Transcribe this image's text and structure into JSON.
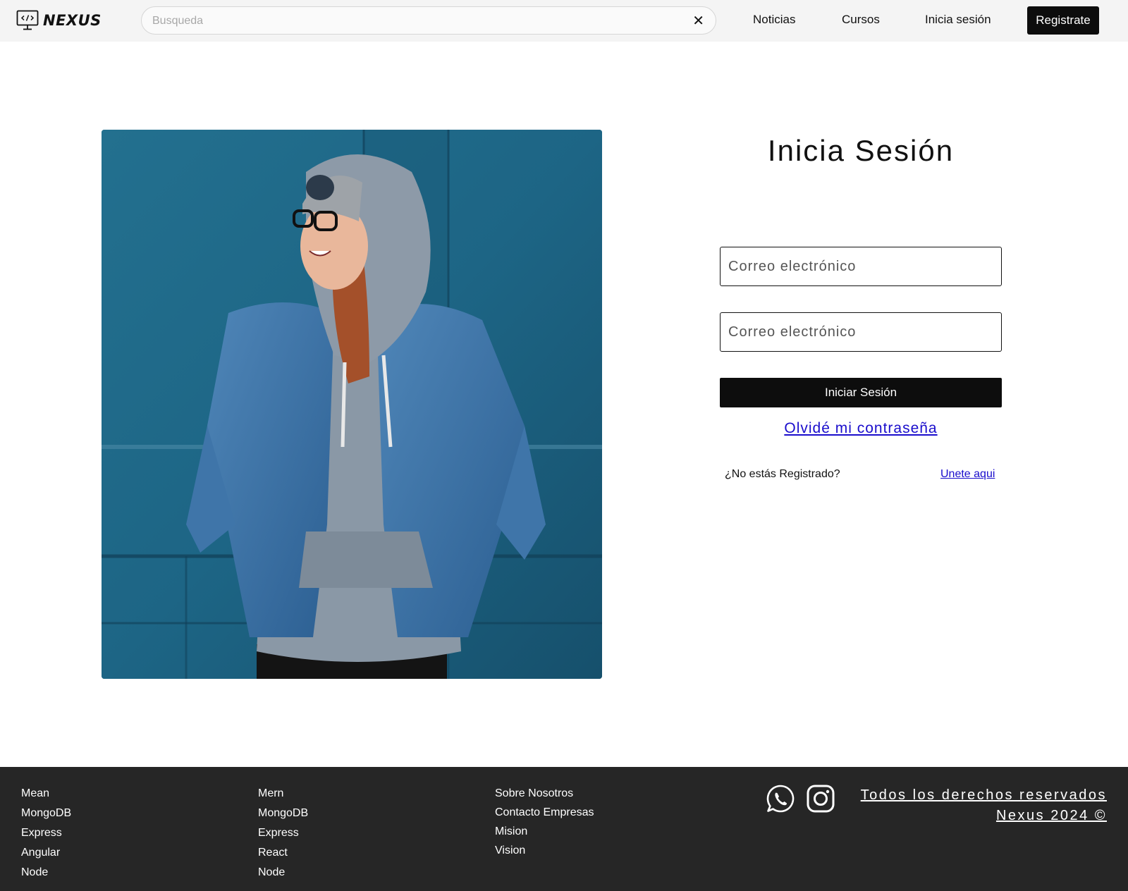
{
  "header": {
    "logo_text": "NEXUS",
    "search_placeholder": "Busqueda",
    "clear_symbol": "✕",
    "nav": {
      "news": "Noticias",
      "courses": "Cursos",
      "login": "Inicia sesión"
    },
    "register_label": "Registrate"
  },
  "hero": {
    "image_icon": "photo-smiling-woman-denim-jacket"
  },
  "login": {
    "title": "Inicia Sesión",
    "email_placeholder": "Correo electrónico",
    "password_placeholder": "Correo electrónico",
    "submit_label": "Iniciar Sesión",
    "forgot_label": "Olvidé mi contraseña",
    "not_registered": "¿No estás Registrado?",
    "join_label": "Unete aqui"
  },
  "footer": {
    "col1": [
      "Mean",
      "MongoDB",
      "Express",
      "Angular",
      "Node"
    ],
    "col2": [
      "Mern",
      "MongoDB",
      "Express",
      "React",
      "Node"
    ],
    "col3": [
      "Sobre Nosotros",
      "Contacto Empresas",
      "Mision",
      "Vision"
    ],
    "social_icons": [
      "whatsapp-icon",
      "instagram-icon"
    ],
    "rights_line1": "Todos los derechos reservados",
    "rights_line2": "Nexus 2024 ©"
  },
  "colors": {
    "header_bg": "#f4f4f4",
    "footer_bg": "#262626",
    "primary_button": "#0d0d0d",
    "link": "#1a0dcc",
    "photo_wall": "#1f6686"
  }
}
